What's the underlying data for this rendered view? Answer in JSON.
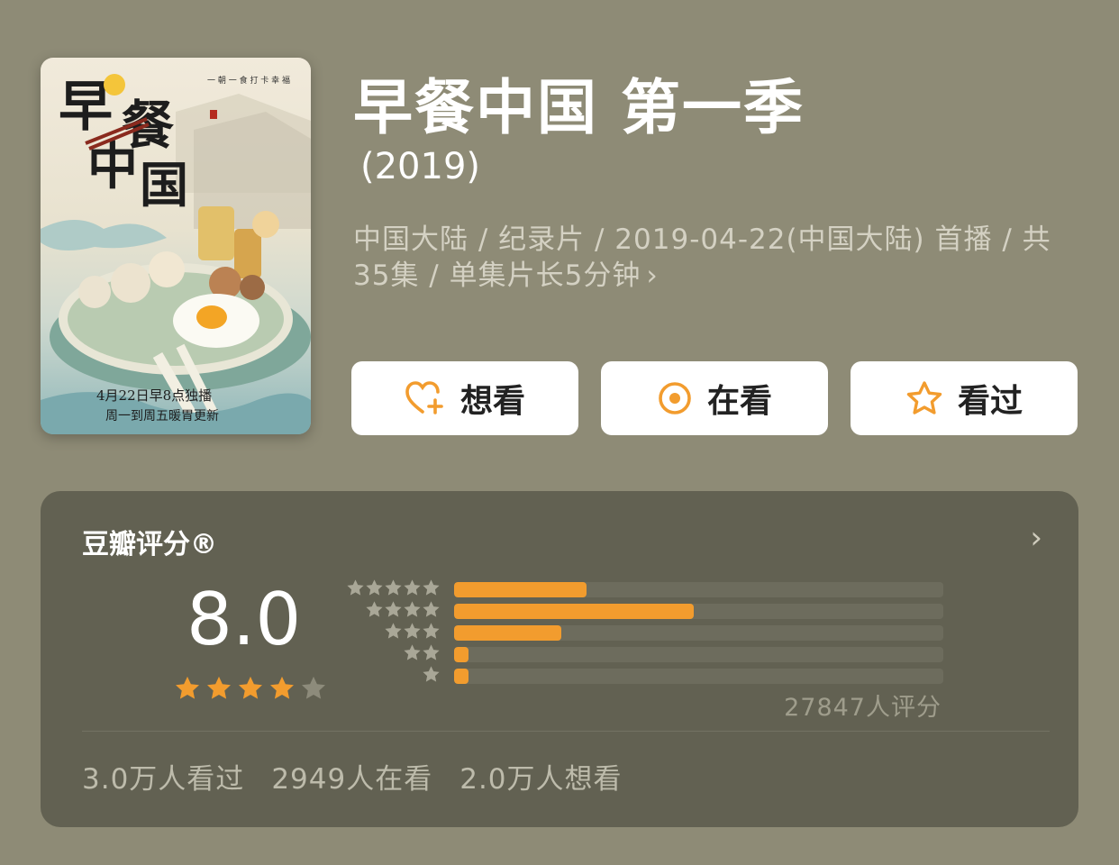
{
  "poster": {
    "title_chars": [
      "早",
      "餐",
      "中",
      "国"
    ],
    "tagline": "一 朝 一 食 打 卡 幸 福",
    "date_line": "4月22日早8点独播",
    "schedule_line": "周一到周五暖胃更新"
  },
  "title": "早餐中国 第一季",
  "year": "(2019)",
  "meta": "中国大陆 / 纪录片 / 2019-04-22(中国大陆) 首播 / 共35集 / 单集片长5分钟",
  "buttons": {
    "want": "想看",
    "watching": "在看",
    "watched": "看过"
  },
  "rating": {
    "title": "豆瓣评分®",
    "score": "8.0",
    "stars": 4,
    "count_text": "27847人评分",
    "distribution": [
      {
        "stars": 5,
        "fraction": 0.27
      },
      {
        "stars": 4,
        "fraction": 0.49
      },
      {
        "stars": 3,
        "fraction": 0.22
      },
      {
        "stars": 2,
        "fraction": 0.03
      },
      {
        "stars": 1,
        "fraction": 0.03
      }
    ]
  },
  "stats": {
    "watched": "3.0万人看过",
    "watching": "2949人在看",
    "want": "2.0万人想看"
  },
  "colors": {
    "background": "#8e8b76",
    "card": "#626152",
    "accent": "#f29c2e",
    "star_empty": "#8d8b7b"
  }
}
